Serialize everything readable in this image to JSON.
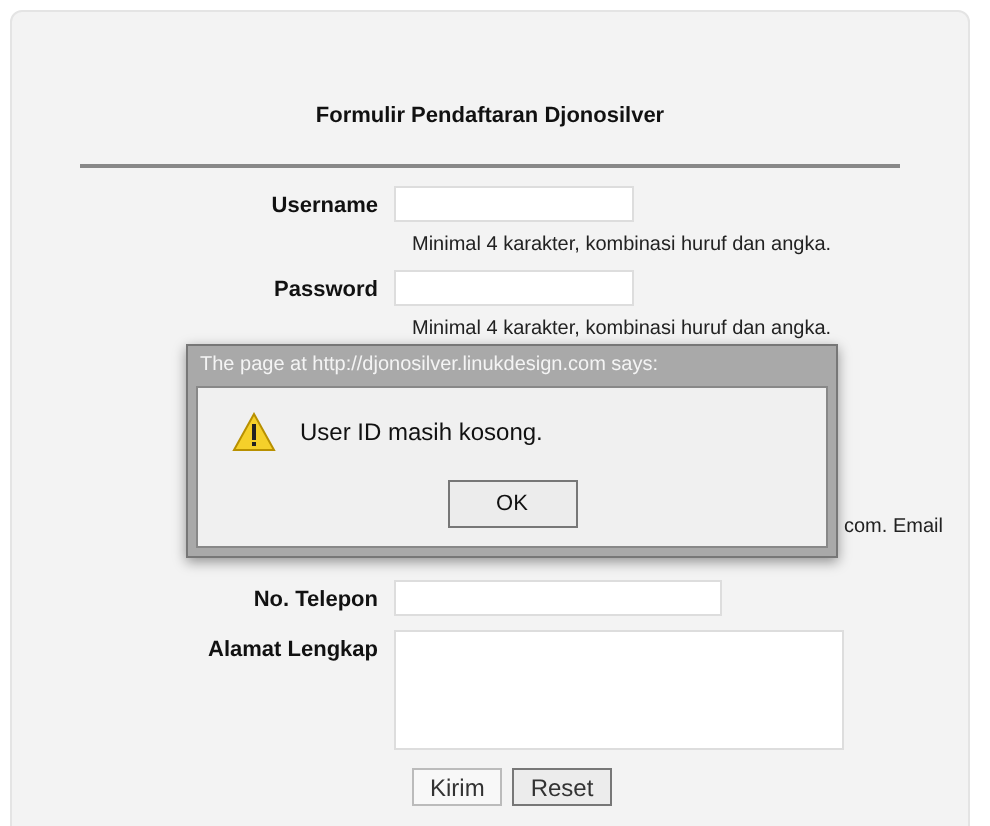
{
  "form": {
    "title": "Formulir Pendaftaran Djonosilver",
    "fields": [
      {
        "label": "Username",
        "hint": "Minimal 4 karakter, kombinasi huruf dan angka.",
        "kind": "input"
      },
      {
        "label": "Password",
        "hint": "Minimal 4 karakter, kombinasi huruf dan angka.",
        "kind": "input"
      }
    ],
    "partial_hint": "com. Email",
    "fields_lower": [
      {
        "label": "No. Telepon",
        "kind": "input"
      },
      {
        "label": "Alamat Lengkap",
        "kind": "textarea"
      }
    ],
    "buttons": [
      "Kirim",
      "Reset"
    ]
  },
  "dialog": {
    "title": "The page at http://djonosilver.linukdesign.com says:",
    "message": "User ID masih kosong.",
    "button": "OK"
  }
}
